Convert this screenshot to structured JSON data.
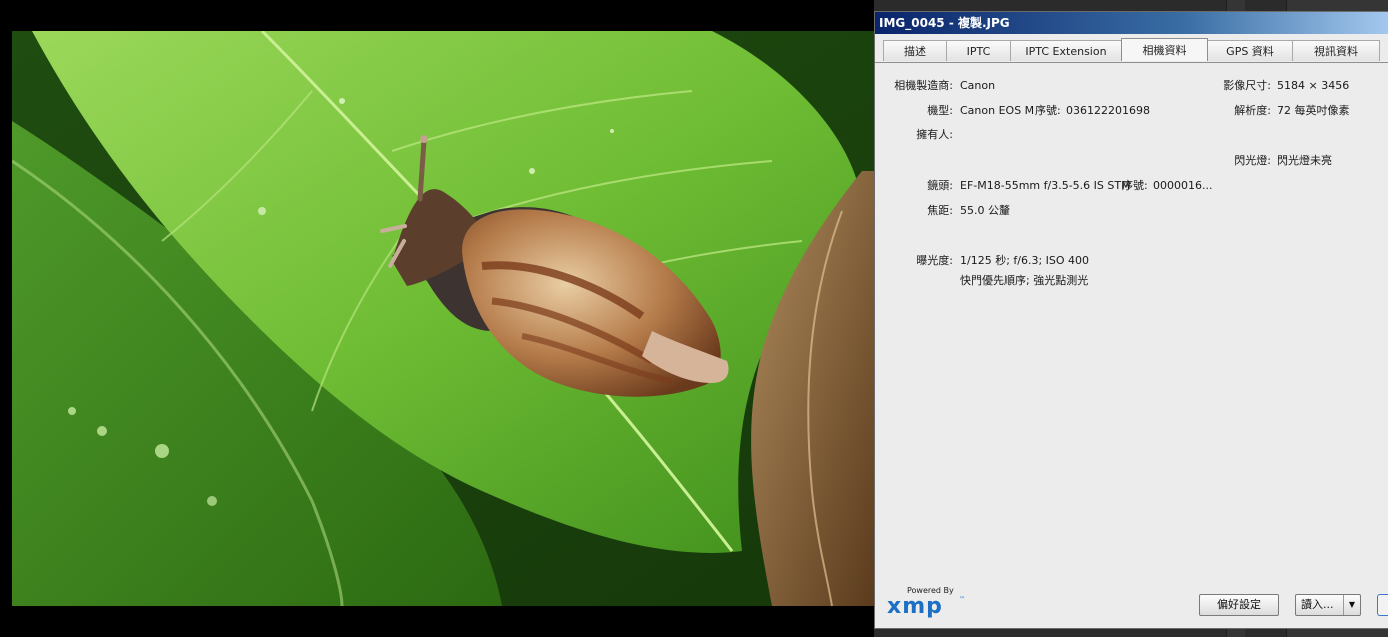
{
  "dialog": {
    "title": "IMG_0045 - 複製.JPG"
  },
  "tabs": [
    {
      "label": "描述",
      "active": false
    },
    {
      "label": "IPTC",
      "active": false
    },
    {
      "label": "IPTC Extension",
      "active": false
    },
    {
      "label": "相機資料",
      "active": true
    },
    {
      "label": "GPS 資料",
      "active": false
    },
    {
      "label": "視訊資料",
      "active": false
    }
  ],
  "camera": {
    "make_label": "相機製造商:",
    "make_value": "Canon",
    "model_label": "機型:",
    "model_value": "Canon EOS M",
    "serial_label": "序號:",
    "serial_value": "036122201698",
    "owner_label": "擁有人:",
    "lens_label": "鏡頭:",
    "lens_value": "EF-M18-55mm f/3.5-5.6 IS STM",
    "lens_serial_label": "序號:",
    "lens_serial_value": "0000016...",
    "focal_label": "焦距:",
    "focal_value": "55.0 公釐",
    "exposure_label": "曝光度:",
    "exposure_value": "1/125 秒;   f/6.3;   ISO 400",
    "exposure_mode": "快門優先順序;   強光點測光",
    "size_label": "影像尺寸:",
    "size_value": "5184 × 3456",
    "resolution_label": "解析度:",
    "resolution_value": "72 每英吋像素",
    "flash_label": "閃光燈:",
    "flash_value": "閃光燈未亮"
  },
  "footer": {
    "powered_by": "Powered By",
    "xmp": "xmp",
    "tm": "™",
    "preferences_button": "偏好設定",
    "import_button": "讀入...",
    "import_arrow": "▼"
  }
}
